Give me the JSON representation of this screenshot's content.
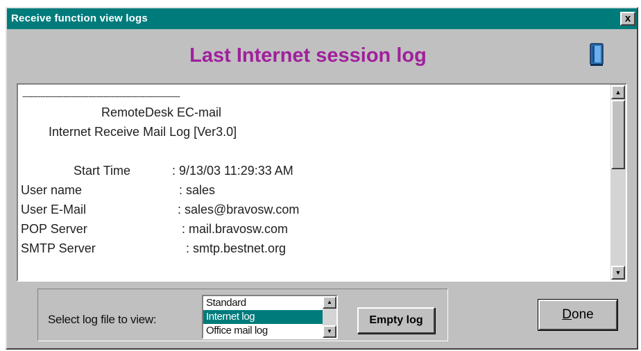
{
  "window": {
    "title": "Receive function view logs",
    "close_label": "x"
  },
  "heading": "Last Internet session log",
  "icons": {
    "help_book": "book-icon",
    "close": "close-icon"
  },
  "log": {
    "separator": "--------------------------------------------------------------",
    "lines": [
      "RemoteDesk EC-mail",
      "Internet Receive Mail Log [Ver3.0]",
      "Start Time",
      ": 9/13/03 11:29:33 AM",
      "User name",
      ": sales",
      "User E-Mail",
      ": sales@bravosw.com",
      "POP Server",
      ": mail.bravosw.com",
      "SMTP Server",
      ": smtp.bestnet.org"
    ]
  },
  "selector": {
    "label": "Select log file to view:",
    "options": [
      "Standard",
      "Internet log",
      "Office mail log"
    ],
    "selected": "Internet log"
  },
  "buttons": {
    "empty_log": "Empty log",
    "done_first": "D",
    "done_rest": "one"
  },
  "colors": {
    "titlebar": "#007b7b",
    "heading": "#a0209c",
    "face": "#c0c0c0"
  }
}
